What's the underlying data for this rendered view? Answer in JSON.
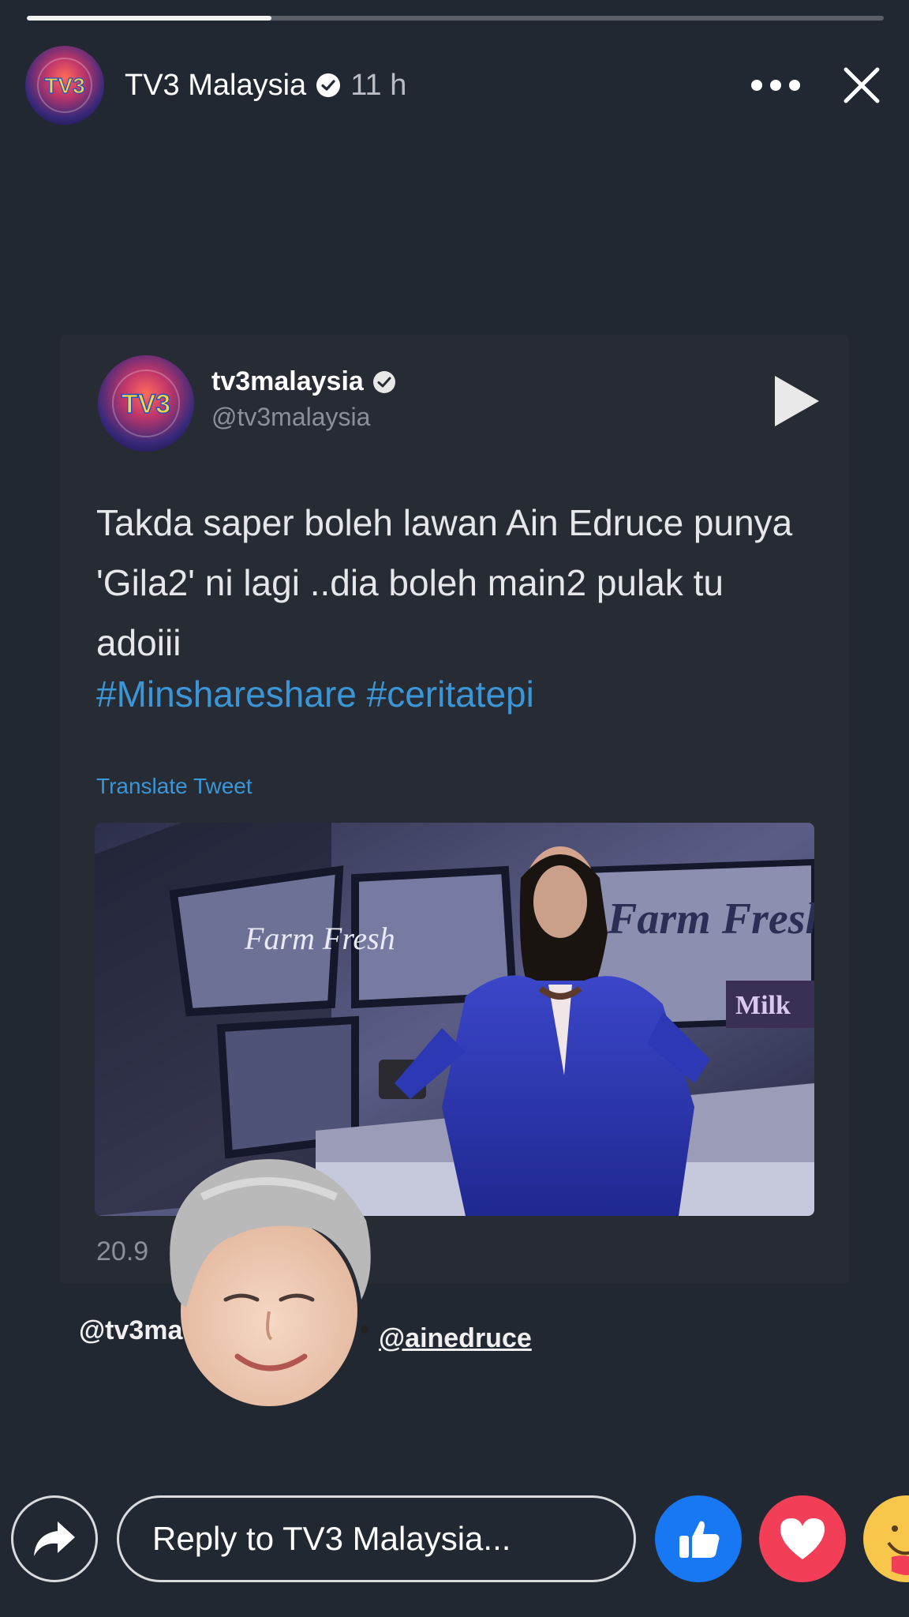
{
  "progress": 0.285,
  "header": {
    "page_name": "TV3 Malaysia",
    "time": "11 h",
    "avatar_text": "TV3"
  },
  "tweet": {
    "name": "tv3malaysia",
    "handle": "@tv3malaysia",
    "text": "Takda saper boleh lawan Ain Edruce punya 'Gila2' ni lagi ..dia boleh main2 pulak tu adoiii",
    "hashtags": "#Minshareshare #ceritatepi",
    "translate_label": "Translate Tweet",
    "count_partial": "20.9",
    "video_brand": "Farm Fresh",
    "video_brand_sub": "Milk"
  },
  "mentions": {
    "left": "@tv3ma",
    "right": "@ainedruce"
  },
  "bottom_bar": {
    "reply_placeholder": "Reply to TV3 Malaysia..."
  },
  "colors": {
    "background": "#222832",
    "link_blue": "#3b96d8",
    "like_blue": "#1877f2",
    "love_red": "#f33e58"
  }
}
